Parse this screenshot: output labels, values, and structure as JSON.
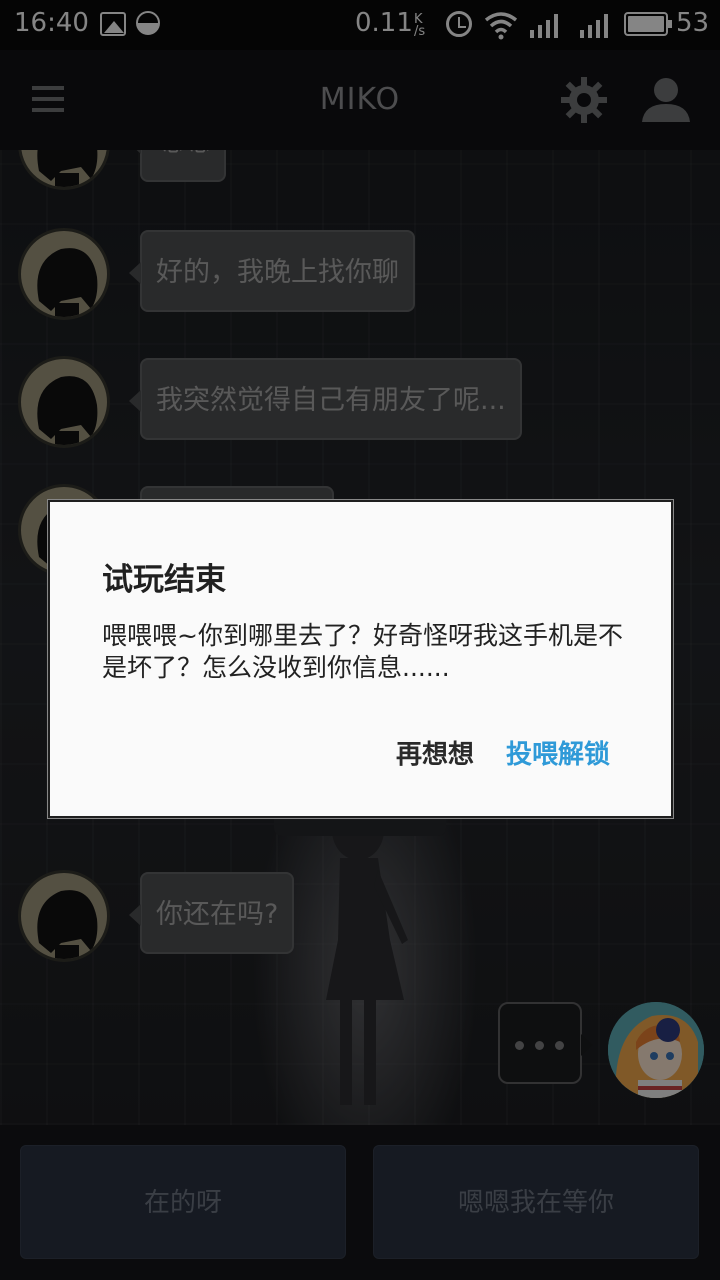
{
  "status_bar": {
    "time": "16:40",
    "network_speed": "0.11",
    "speed_unit_top": "K",
    "speed_unit_bottom": "/s",
    "battery": "53",
    "icons": [
      "gallery-icon",
      "moon-icon",
      "alarm-icon",
      "wifi-icon",
      "signal-icon",
      "signal-icon",
      "battery-icon"
    ]
  },
  "app_bar": {
    "title": "MIKO",
    "icons": [
      "menu-icon",
      "gear-icon",
      "profile-icon"
    ]
  },
  "messages": [
    {
      "sender": "MIKO",
      "text": "嗯嗯"
    },
    {
      "sender": "MIKO",
      "text": "好的，我晚上找你聊"
    },
    {
      "sender": "MIKO",
      "text": "我突然觉得自己有朋友了呢..."
    },
    {
      "sender": "MIKO",
      "text": ""
    },
    {
      "sender": "MIKO",
      "text": "你还在吗?"
    }
  ],
  "typing_indicator": "...",
  "reply_options": [
    "在的呀",
    "嗯嗯我在等你"
  ],
  "dialog": {
    "title": "试玩结束",
    "message": "喂喂喂~你到哪里去了？好奇怪呀我这手机是不是坏了？怎么没收到你信息......",
    "cancel_label": "再想想",
    "confirm_label": "投喂解锁",
    "confirm_color": "#2f9ad8"
  }
}
